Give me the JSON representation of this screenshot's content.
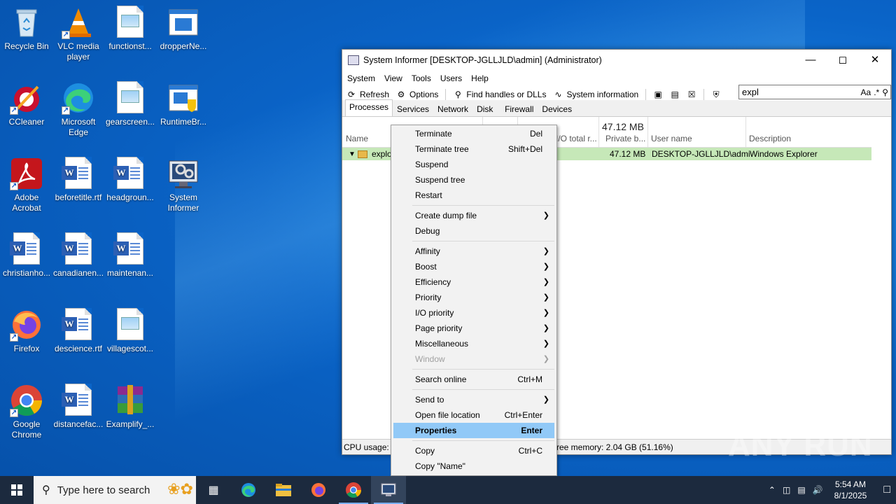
{
  "desktop": {
    "icons": [
      {
        "label": "Recycle Bin"
      },
      {
        "label": "VLC media player"
      },
      {
        "label": "functionst..."
      },
      {
        "label": "dropperNe..."
      },
      {
        "label": "CCleaner"
      },
      {
        "label": "Microsoft Edge"
      },
      {
        "label": "gearscreen..."
      },
      {
        "label": "RuntimeBr..."
      },
      {
        "label": "Adobe Acrobat"
      },
      {
        "label": "beforetitle.rtf"
      },
      {
        "label": "headgroun..."
      },
      {
        "label": "System Informer"
      },
      {
        "label": "christianho..."
      },
      {
        "label": "canadianen..."
      },
      {
        "label": "maintenan..."
      },
      {
        "label": "Firefox"
      },
      {
        "label": "descience.rtf"
      },
      {
        "label": "villagescot..."
      },
      {
        "label": "Google Chrome"
      },
      {
        "label": "distancefac..."
      },
      {
        "label": "Examplify_..."
      }
    ]
  },
  "window": {
    "title": "System Informer [DESKTOP-JGLLJLD\\admin] (Administrator)",
    "menu": [
      "System",
      "View",
      "Tools",
      "Users",
      "Help"
    ],
    "toolbar": {
      "refresh": "Refresh",
      "options": "Options",
      "find_handles": "Find handles or DLLs",
      "system_information": "System information"
    },
    "search": {
      "value": "expl",
      "case_toggle": "Aa",
      "regex_toggle": ".*"
    },
    "tabs": [
      "Processes",
      "Services",
      "Network",
      "Disk",
      "Firewall",
      "Devices"
    ],
    "columns": {
      "name": "Name",
      "io_total": "I/O total r...",
      "private_bytes_total": "47.12 MB",
      "private_bytes": "Private b...",
      "user_name": "User name",
      "description": "Description"
    },
    "process_row": {
      "name": "explo",
      "private_bytes": "47.12 MB",
      "user_name": "DESKTOP-JGLLJLD\\admi",
      "description": "Windows Explorer"
    },
    "status": {
      "cpu_usage": "CPU usage: 5",
      "free_memory": "ree memory: 2.04 GB (51.16%)"
    }
  },
  "context_menu": {
    "items": [
      {
        "label": "Terminate",
        "shortcut": "Del"
      },
      {
        "label": "Terminate tree",
        "shortcut": "Shift+Del"
      },
      {
        "label": "Suspend",
        "shortcut": ""
      },
      {
        "label": "Suspend tree",
        "shortcut": ""
      },
      {
        "label": "Restart",
        "shortcut": ""
      },
      {
        "label": "Create dump file",
        "shortcut": ""
      },
      {
        "label": "Debug",
        "shortcut": ""
      },
      {
        "label": "Affinity",
        "shortcut": ""
      },
      {
        "label": "Boost",
        "shortcut": ""
      },
      {
        "label": "Efficiency",
        "shortcut": ""
      },
      {
        "label": "Priority",
        "shortcut": ""
      },
      {
        "label": "I/O priority",
        "shortcut": ""
      },
      {
        "label": "Page priority",
        "shortcut": ""
      },
      {
        "label": "Miscellaneous",
        "shortcut": ""
      },
      {
        "label": "Window",
        "shortcut": ""
      },
      {
        "label": "Search online",
        "shortcut": "Ctrl+M"
      },
      {
        "label": "Send to",
        "shortcut": ""
      },
      {
        "label": "Open file location",
        "shortcut": "Ctrl+Enter"
      },
      {
        "label": "Properties",
        "shortcut": "Enter"
      },
      {
        "label": "Copy",
        "shortcut": "Ctrl+C"
      },
      {
        "label": "Copy \"Name\"",
        "shortcut": ""
      }
    ]
  },
  "taskbar": {
    "search_placeholder": "Type here to search",
    "time": "5:54 AM",
    "date": "8/1/2025"
  },
  "watermark": "ANY RUN",
  "colors": {
    "highlight": "#91c9f7",
    "row_new": "#c6e8b8",
    "taskbar": "#1c2a3e"
  }
}
